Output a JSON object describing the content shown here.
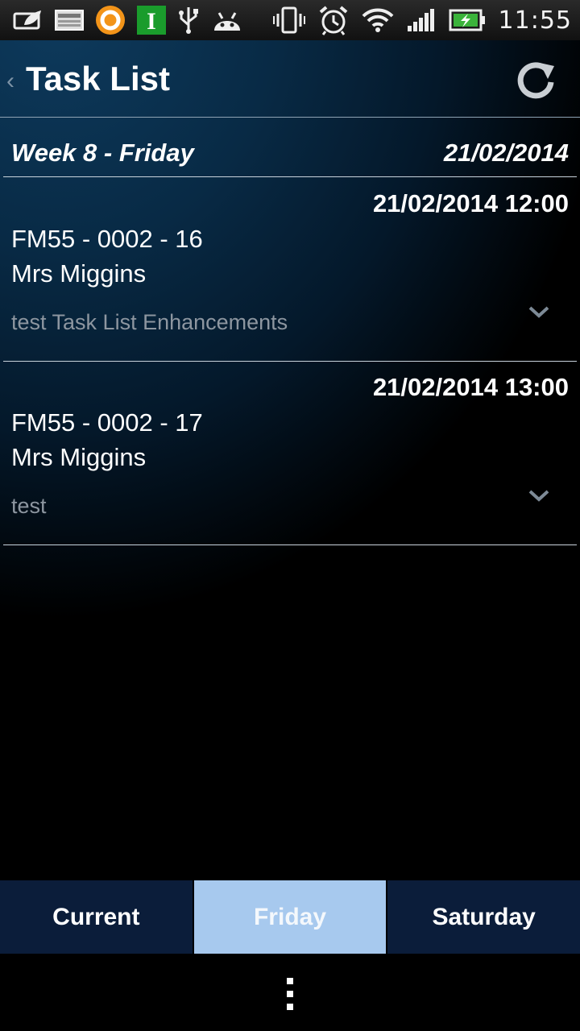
{
  "status_bar": {
    "time": "11:55",
    "icons": [
      "leaf-notification-icon",
      "image-notification-icon",
      "orange-app-icon",
      "i-app-icon",
      "usb-icon",
      "android-debug-icon",
      "vibrate-icon",
      "alarm-icon",
      "wifi-icon",
      "signal-icon",
      "battery-charging-icon"
    ],
    "app_letter": "I"
  },
  "header": {
    "back_glyph": "‹",
    "title": "Task List"
  },
  "section": {
    "title": "Week 8 - Friday",
    "date": "21/02/2014"
  },
  "tasks": [
    {
      "datetime": "21/02/2014 12:00",
      "reference": "FM55 - 0002 - 16",
      "name": "Mrs Miggins",
      "description": "test Task List Enhancements"
    },
    {
      "datetime": "21/02/2014 13:00",
      "reference": "FM55 - 0002 - 17",
      "name": "Mrs Miggins",
      "description": "test"
    }
  ],
  "tabs": [
    {
      "label": "Current",
      "selected": false
    },
    {
      "label": "Friday",
      "selected": true
    },
    {
      "label": "Saturday",
      "selected": false
    }
  ],
  "colors": {
    "selected_tab": "#a7c9ee",
    "tab_background": "#0b1d3a",
    "description_text": "#8d96a0"
  }
}
